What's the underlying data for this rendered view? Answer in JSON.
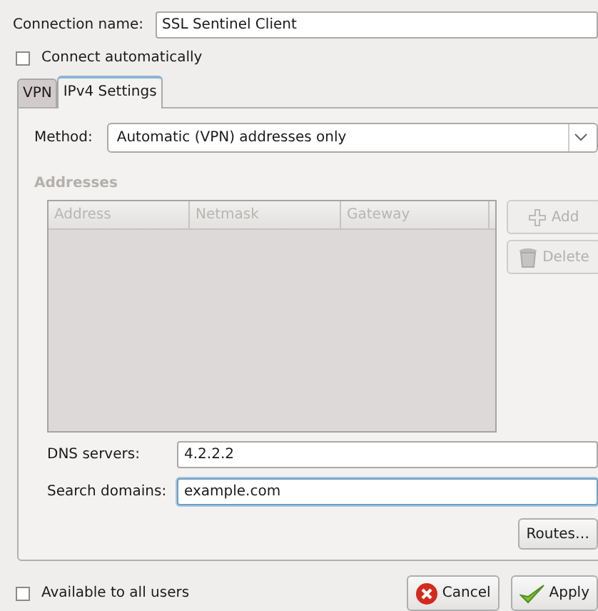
{
  "connection_name": {
    "label": "Connection name:",
    "value": "SSL Sentinel Client"
  },
  "connect_automatically": {
    "label": "Connect automatically",
    "checked": false
  },
  "tabs": [
    {
      "label": "VPN",
      "selected": false
    },
    {
      "label": "IPv4 Settings",
      "selected": true
    }
  ],
  "method": {
    "label": "Method:",
    "value": "Automatic (VPN) addresses only"
  },
  "addresses": {
    "title": "Addresses",
    "disabled": true,
    "columns": [
      "Address",
      "Netmask",
      "Gateway"
    ],
    "buttons": [
      {
        "kind": "add",
        "label": "Add",
        "disabled": true
      },
      {
        "kind": "delete",
        "label": "Delete",
        "disabled": true
      }
    ]
  },
  "fields": [
    {
      "label": "DNS servers:",
      "value": "4.2.2.2",
      "focused": false
    },
    {
      "label": "Search domains:",
      "value": "example.com",
      "focused": true
    }
  ],
  "routes_button": "Routes…",
  "available_to_all_users": {
    "label": "Available to all users",
    "checked": false
  },
  "buttons": [
    {
      "kind": "cancel",
      "label": "Cancel"
    },
    {
      "kind": "apply",
      "label": "Apply"
    }
  ]
}
